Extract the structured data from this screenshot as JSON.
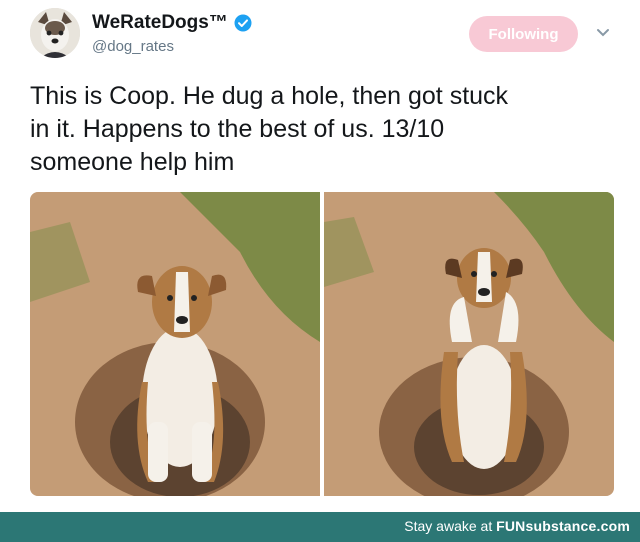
{
  "account": {
    "display_name": "WeRateDogs™",
    "handle": "@dog_rates",
    "verified": true,
    "avatar_icon": "dog-avatar-icon"
  },
  "actions": {
    "follow_label": "Following",
    "menu_icon": "chevron-down-icon"
  },
  "tweet": {
    "text_line1": "This is Coop. He dug a hole, then got stuck",
    "text_line2": "in it. Happens to the best of us. 13/10",
    "text_line3": "someone help him"
  },
  "media": {
    "photos": [
      "dog-in-hole-photo-1",
      "dog-in-hole-photo-2"
    ]
  },
  "footer": {
    "prefix": "Stay awake at ",
    "brand": "FUNsubstance.com"
  },
  "colors": {
    "follow_button_bg": "#f8c9d5",
    "verified_blue": "#1da1f2",
    "footer_bg": "#2c7775"
  }
}
